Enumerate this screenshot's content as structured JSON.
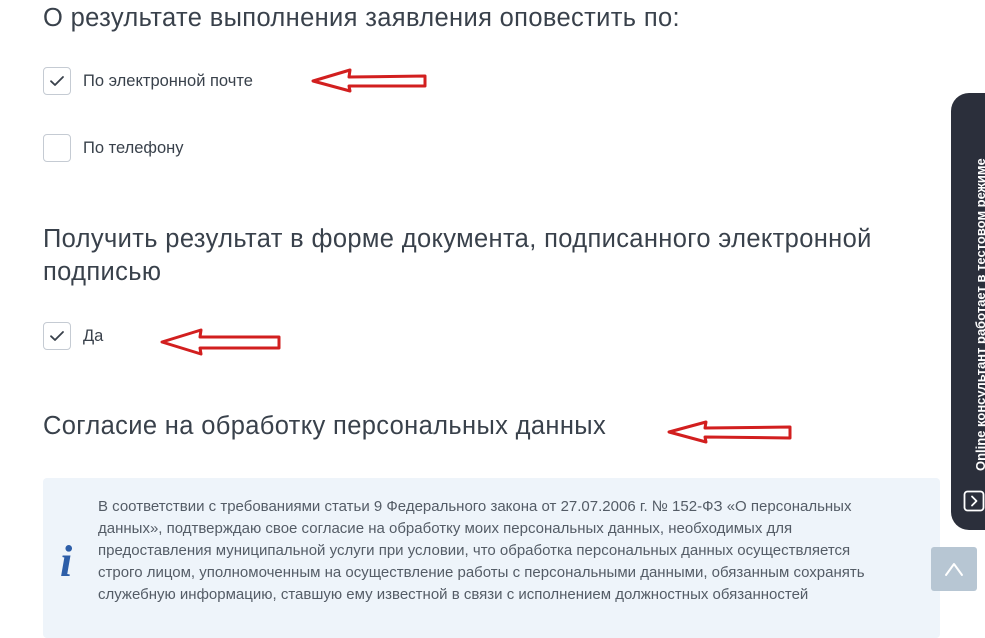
{
  "notification": {
    "heading": "О результате выполнения заявления оповестить по:",
    "options": [
      {
        "label": "По электронной почте",
        "checked": true
      },
      {
        "label": "По телефону",
        "checked": false
      }
    ]
  },
  "signed_result": {
    "heading": "Получить результат в форме документа, подписанного электронной подписью",
    "option": {
      "label": "Да",
      "checked": true
    }
  },
  "consent": {
    "heading": "Согласие на обработку персональных данных",
    "info_icon": "i",
    "text": "В соответствии с требованиями статьи 9 Федерального закона от 27.07.2006 г. № 152-ФЗ «О персональных данных», подтверждаю свое согласие на обработку моих персональных данных, необходимых для предоставления муниципальной услуги при условии, что обработка персональных данных осуществляется строго лицом, уполномоченным на осуществление работы с персональными данными, обязанным сохранять служебную информацию, ставшую ему известной в связи с исполнением должностных обязанностей"
  },
  "online_consultant": {
    "label": "Online консультант работает в тестовом режиме",
    "icon": "chevron-right-icon"
  },
  "scroll_top": {
    "icon": "chevron-up-icon"
  },
  "colors": {
    "accent": "#2d5ea8",
    "annotation_red": "#d21f1f",
    "info_background": "#eef4fa",
    "consultant_background": "#2b2f3b",
    "scroll_button": "#b7c6d3"
  }
}
